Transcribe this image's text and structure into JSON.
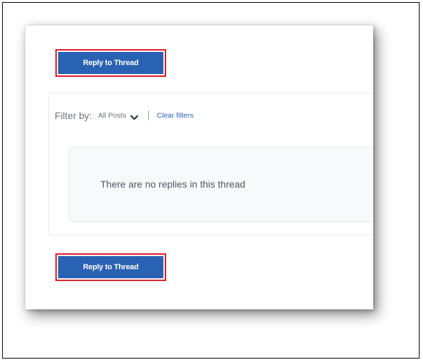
{
  "thread": {
    "reply_top_label": "Reply to Thread",
    "reply_bottom_label": "Reply to Thread"
  },
  "filter": {
    "label": "Filter by:",
    "selected": "All Posts",
    "clear_label": "Clear filters"
  },
  "empty_state": {
    "message": "There are no replies in this thread"
  },
  "icons": {
    "dropdown": "chevron-down-icon"
  },
  "colors": {
    "button_blue": "#2a62b3",
    "highlight_red": "#e01a26",
    "link_blue": "#2a62b3"
  }
}
